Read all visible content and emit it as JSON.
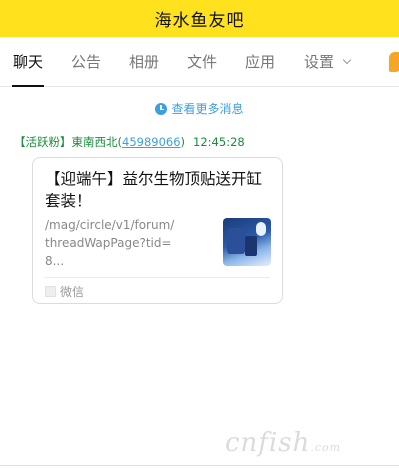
{
  "window": {
    "title": "海水鱼友吧"
  },
  "tabs": {
    "chat": "聊天",
    "notice": "公告",
    "album": "相册",
    "files": "文件",
    "apps": "应用",
    "settings": "设置"
  },
  "history": {
    "label": "查看更多消息"
  },
  "message": {
    "sender_badge": "【活跃粉】",
    "sender_name": "東南西北",
    "qq_open": "(",
    "qq_number": "45989066",
    "qq_close": ")",
    "time": "12:45:28",
    "card": {
      "title": "【迎端午】益尔生物顶贴送开缸套装！",
      "url": "/mag/circle/v1/forum/threadWapPage?tid=8...",
      "source": "微信"
    }
  },
  "watermark": {
    "text": "cnfish",
    "suffix": ".com"
  },
  "colors": {
    "titlebar_bg": "#ffe21d",
    "link_blue": "#3b9fe0",
    "sender_green": "#1a8c3a"
  },
  "icons": [
    "clock-icon",
    "chevron-down-icon",
    "source-icon",
    "edge-icon"
  ]
}
